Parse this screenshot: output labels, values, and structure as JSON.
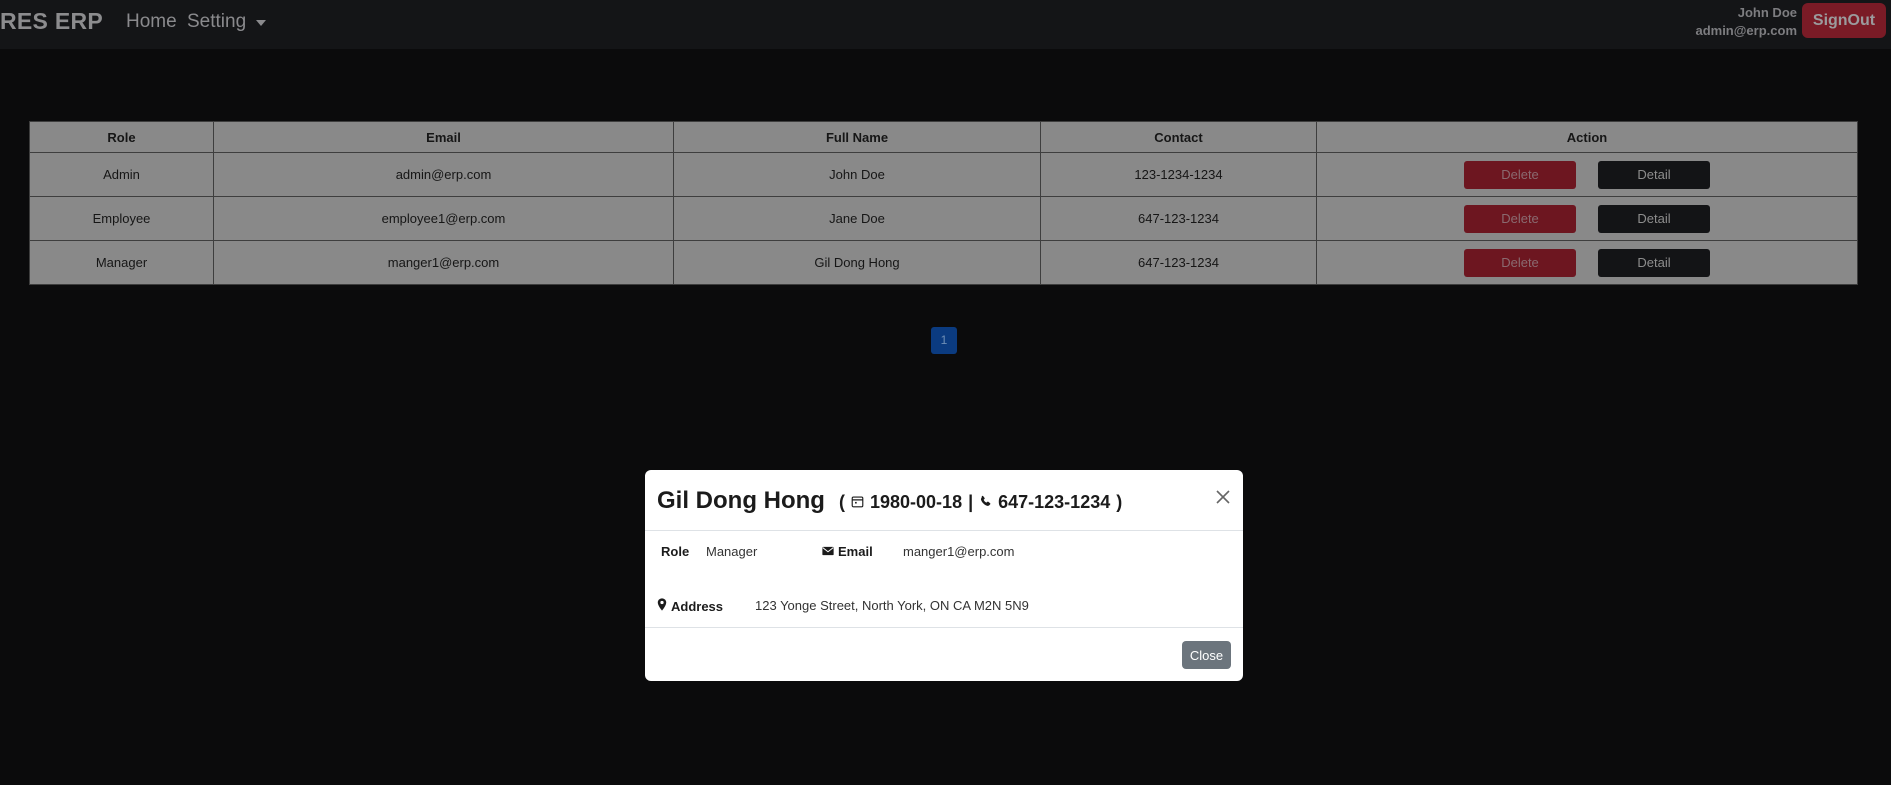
{
  "navbar": {
    "brand": "RES ERP",
    "home_label": "Home",
    "setting_label": "Setting",
    "user_name": "John Doe",
    "user_email": "admin@erp.com",
    "signout_label": "SignOut"
  },
  "table": {
    "headers": [
      "Role",
      "Email",
      "Full Name",
      "Contact",
      "Action"
    ],
    "rows": [
      {
        "role": "Admin",
        "email": "admin@erp.com",
        "full_name": "John Doe",
        "contact": "123-1234-1234",
        "delete_label": "Delete",
        "detail_label": "Detail"
      },
      {
        "role": "Employee",
        "email": "employee1@erp.com",
        "full_name": "Jane Doe",
        "contact": "647-123-1234",
        "delete_label": "Delete",
        "detail_label": "Detail"
      },
      {
        "role": "Manager",
        "email": "manger1@erp.com",
        "full_name": "Gil Dong Hong",
        "contact": "647-123-1234",
        "delete_label": "Delete",
        "detail_label": "Detail"
      }
    ]
  },
  "pagination": {
    "current_page": "1"
  },
  "modal": {
    "title": "Gil Dong Hong",
    "open_paren": "(",
    "birth_date": "1980-00-18",
    "separator": "|",
    "phone": "647-123-1234",
    "close_paren": ")",
    "role_label": "Role",
    "role_value": "Manager",
    "email_label": "Email",
    "email_value": "manger1@erp.com",
    "address_label": "Address",
    "address_value": "123 Yonge Street, North York, ON CA M2N 5N9",
    "close_label": "Close"
  },
  "icons": [
    "calendar-icon",
    "phone-icon",
    "envelope-icon",
    "map-pin-icon",
    "close-icon",
    "chevron-down-icon"
  ],
  "colors": {
    "background": "#0b0b0c",
    "navbar": "#141517",
    "danger": "#7a1b26",
    "primary": "#0b3b80",
    "secondary": "#6c757d",
    "table_bg": "#898989"
  }
}
